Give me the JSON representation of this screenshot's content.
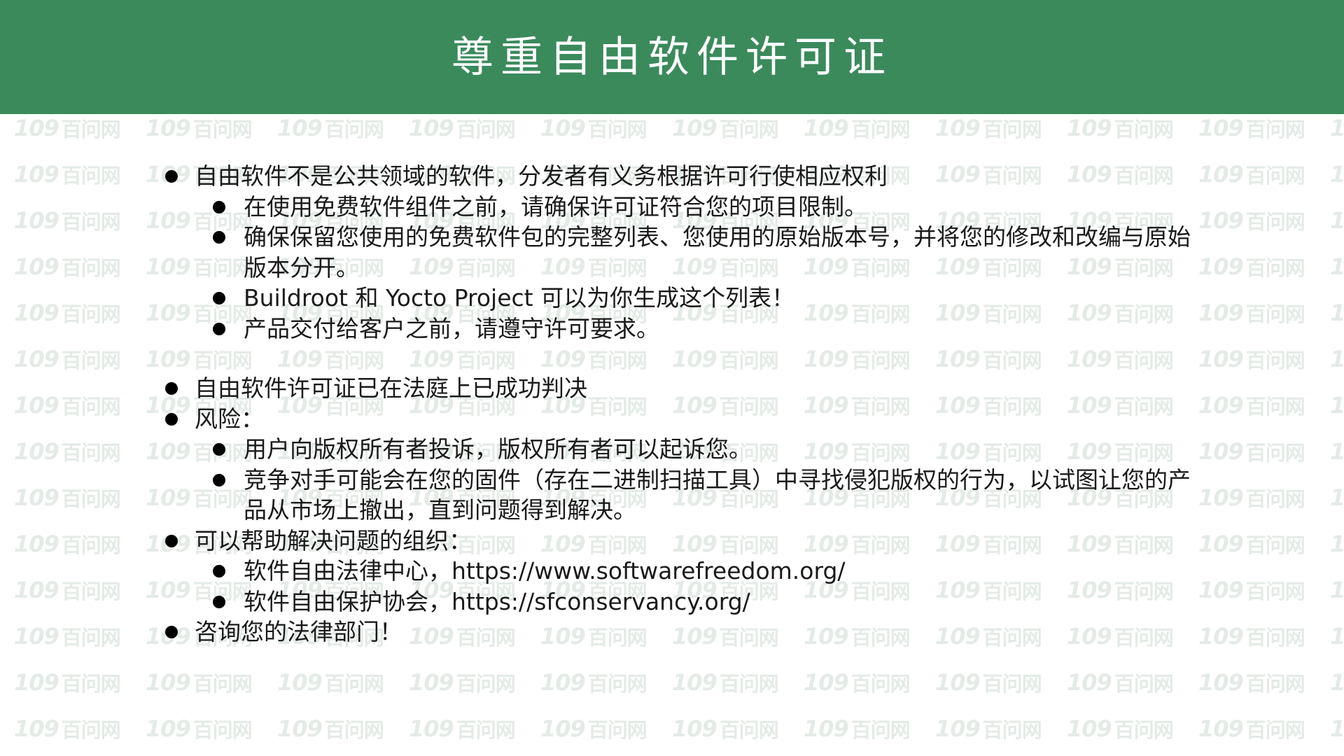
{
  "header": {
    "title": "尊重自由软件许可证",
    "background_color": "#3b8a5c",
    "text_color": "#ffffff"
  },
  "watermark": {
    "number": "109",
    "label": "百问网"
  },
  "content": {
    "groups": [
      {
        "items": [
          {
            "text": "自由软件不是公共领域的软件，分发者有义务根据许可行使相应权利",
            "children": [
              {
                "text": "在使用免费软件组件之前，请确保许可证符合您的项目限制。"
              },
              {
                "text": "确保保留您使用的免费软件包的完整列表、您使用的原始版本号，并将您的修改和改编与原始版本分开。"
              },
              {
                "text": "Buildroot 和 Yocto Project 可以为你生成这个列表！"
              },
              {
                "text": "产品交付给客户之前，请遵守许可要求。"
              }
            ]
          }
        ]
      },
      {
        "items": [
          {
            "text": "自由软件许可证已在法庭上已成功判决",
            "children": []
          },
          {
            "text": "风险：",
            "children": [
              {
                "text": "用户向版权所有者投诉，版权所有者可以起诉您。"
              },
              {
                "text": "竞争对手可能会在您的固件（存在二进制扫描工具）中寻找侵犯版权的行为，以试图让您的产品从市场上撤出，直到问题得到解决。"
              }
            ]
          },
          {
            "text": "可以帮助解决问题的组织：",
            "children": [
              {
                "text": "软件自由法律中心，https://www.softwarefreedom.org/"
              },
              {
                "text": "软件自由保护协会，https://sfconservancy.org/"
              }
            ]
          },
          {
            "text": "咨询您的法律部门！",
            "children": []
          }
        ]
      }
    ]
  }
}
